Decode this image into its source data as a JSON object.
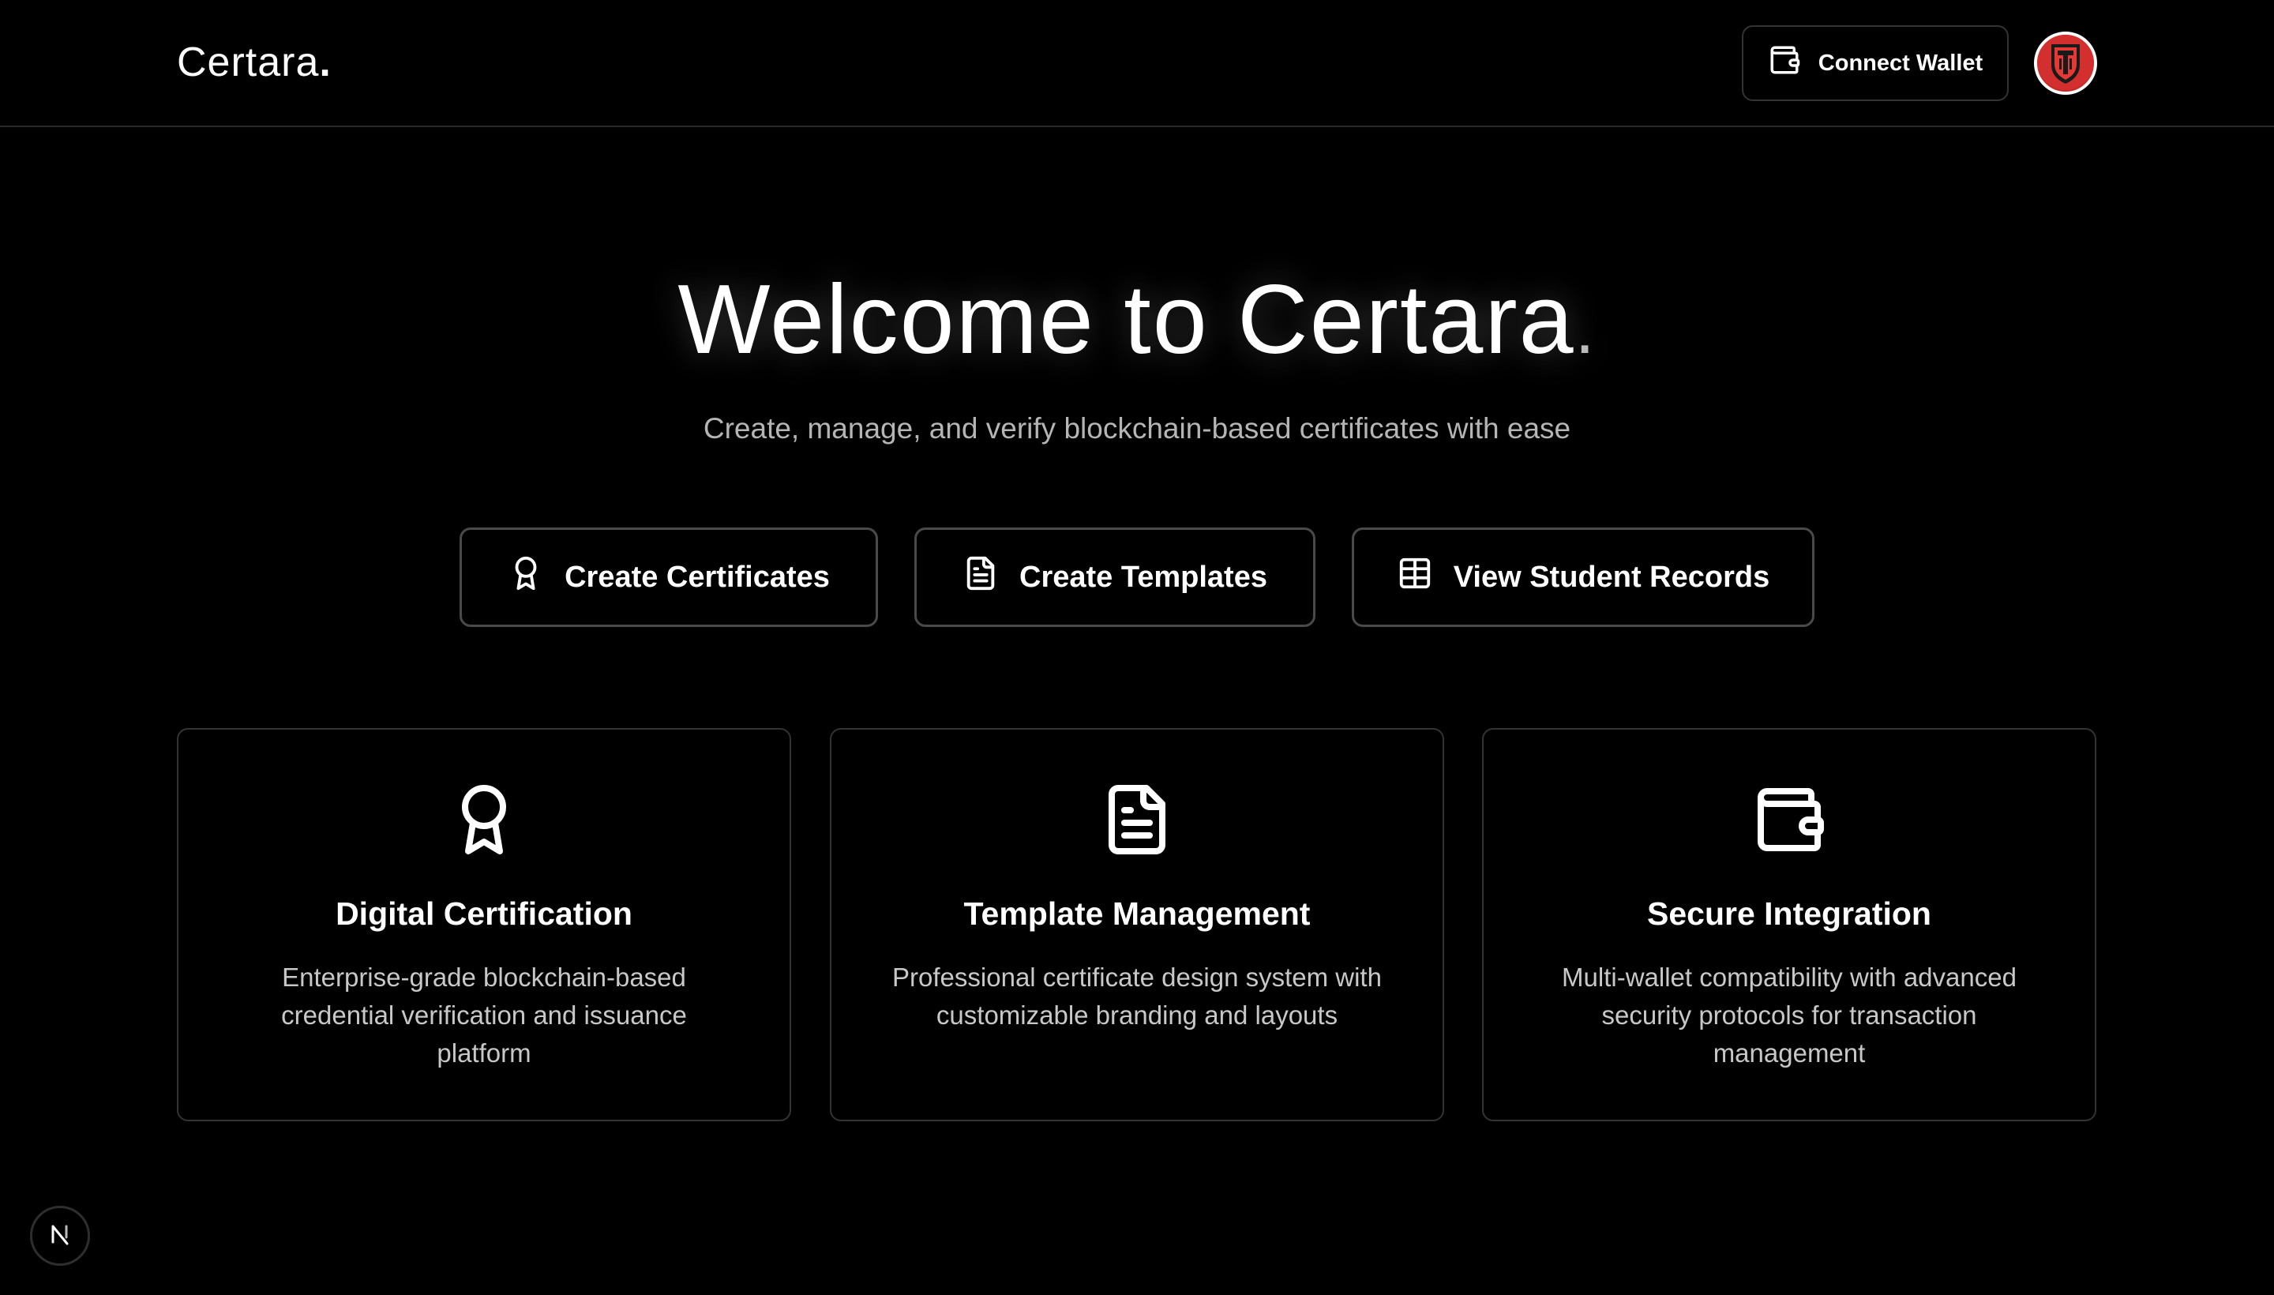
{
  "header": {
    "logo_text": "Certara",
    "logo_dot": ".",
    "connect_wallet_label": "Connect Wallet",
    "wallet_icon": "wallet-icon",
    "avatar_icon": "helmet-shield-icon"
  },
  "hero": {
    "title": "Welcome to Certara",
    "title_dot": ".",
    "subtitle": "Create, manage, and verify blockchain-based certificates with ease"
  },
  "actions": [
    {
      "label": "Create Certificates",
      "icon": "award-icon"
    },
    {
      "label": "Create Templates",
      "icon": "file-text-icon"
    },
    {
      "label": "View Student Records",
      "icon": "table-icon"
    }
  ],
  "features": [
    {
      "icon": "award-icon",
      "title": "Digital Certification",
      "description": "Enterprise-grade blockchain-based credential verification and issuance platform"
    },
    {
      "icon": "file-text-icon",
      "title": "Template Management",
      "description": "Professional certificate design system with customizable branding and layouts"
    },
    {
      "icon": "wallet-icon",
      "title": "Secure Integration",
      "description": "Multi-wallet compatibility with advanced security protocols for transaction management"
    }
  ],
  "dev_badge": {
    "icon": "nextjs-logo-icon",
    "letter": "N"
  },
  "colors": {
    "background": "#000000",
    "text": "#ffffff",
    "muted_text": "#b5b5b5",
    "border": "#333333",
    "avatar_bg": "#c62828"
  }
}
